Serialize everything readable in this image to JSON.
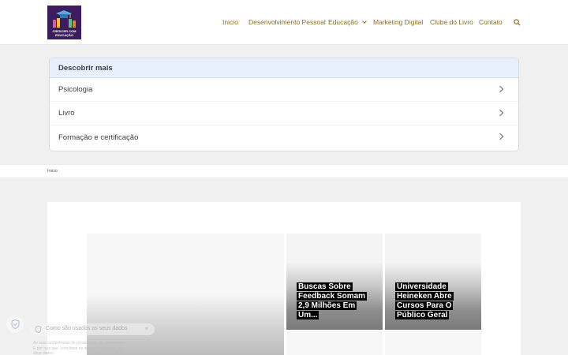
{
  "header": {
    "logo_text": [
      "CRESCER COM",
      "EDUCAÇÃO"
    ],
    "nav": [
      {
        "label": "Inicio"
      },
      {
        "label": "Desenvolvimento Pessoal"
      },
      {
        "label": "Educação"
      },
      {
        "label": "Marketing Digital"
      },
      {
        "label": "Clube do Livro"
      },
      {
        "label": "Contato"
      }
    ],
    "accent_color": "#8a6d1e"
  },
  "discover": {
    "title": "Descobrir mais",
    "items": [
      "Psicologia",
      "Livro",
      "Formação e certificação"
    ]
  },
  "breadcrumb": {
    "current": "Inicio"
  },
  "cards": [
    {
      "title": ""
    },
    {
      "title": "Buscas Sobre Feedback Somam 2,9 Milhões Em Um..."
    },
    {
      "title": "Universidade Heineken Abre Cursos Para O Público Geral"
    }
  ],
  "privacy": {
    "title": "Como são usados os seus dados",
    "close": "×",
    "body": "As suas preferências de privacidade são importantes. E por isso que, com base no interesse legítimo, dos seus dados"
  }
}
